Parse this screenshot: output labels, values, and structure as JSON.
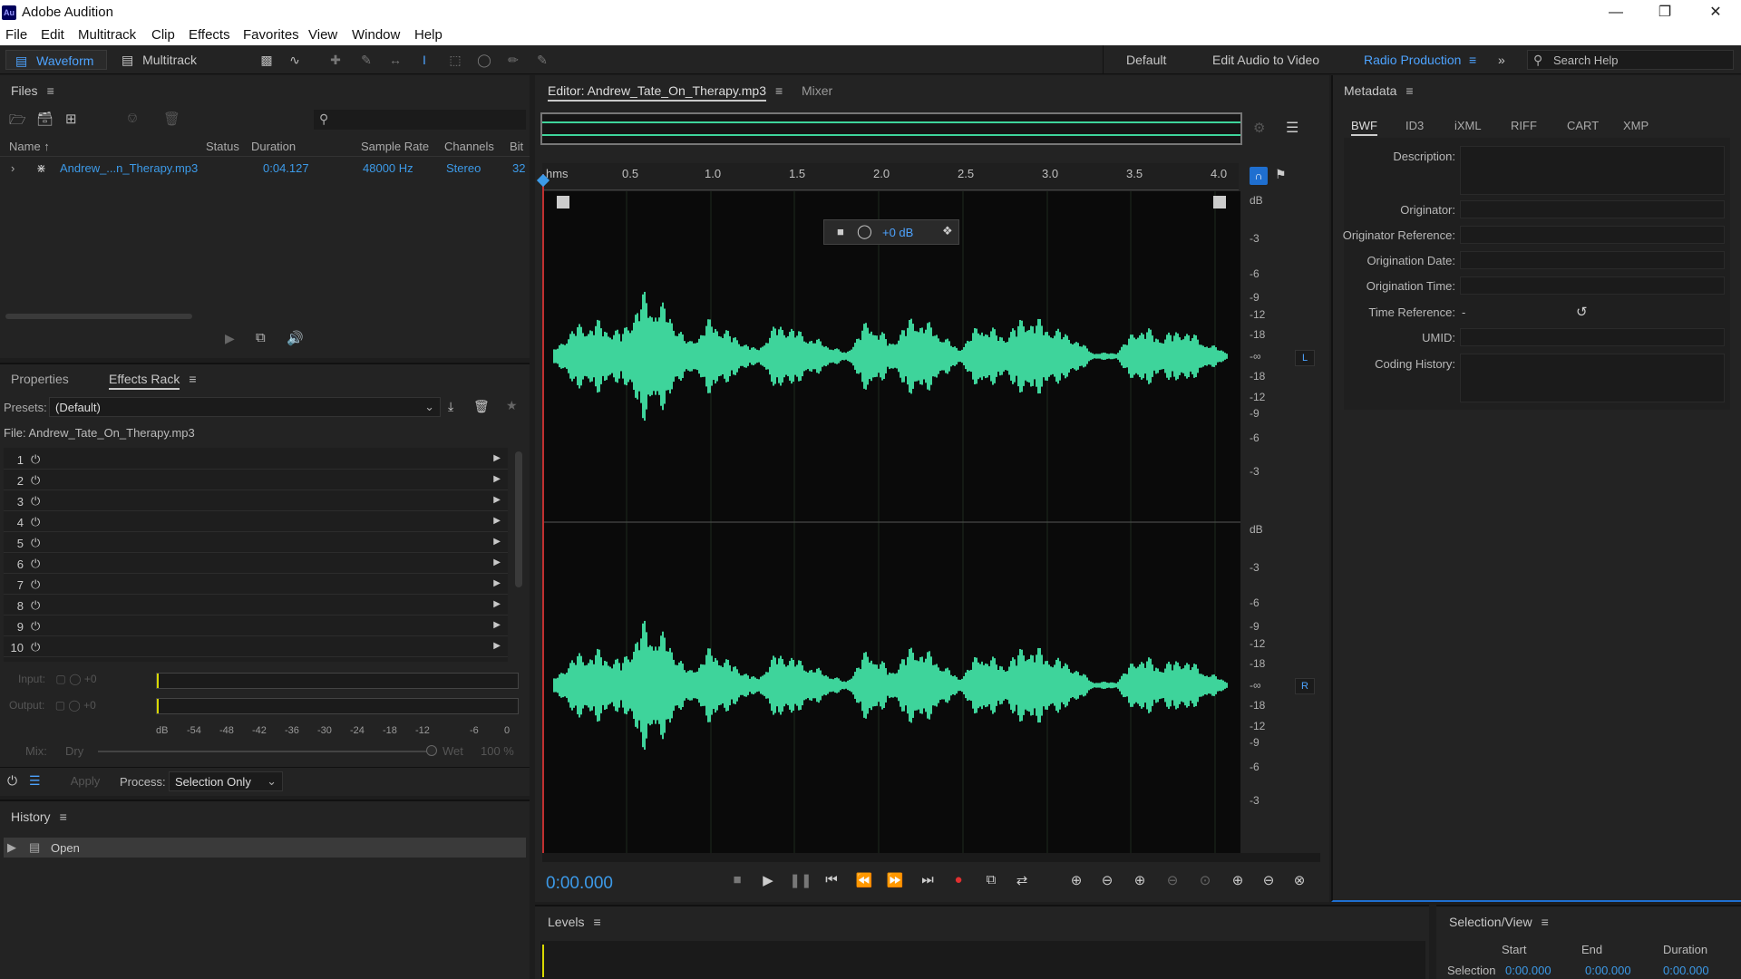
{
  "app": {
    "title": "Adobe Audition",
    "logo": "Au"
  },
  "menu": [
    "File",
    "Edit",
    "Multitrack",
    "Clip",
    "Effects",
    "Favorites",
    "View",
    "Window",
    "Help"
  ],
  "toolbar": {
    "waveform_label": "Waveform",
    "multitrack_label": "Multitrack",
    "workspaces": [
      "Default",
      "Edit Audio to Video",
      "Radio Production"
    ],
    "search_placeholder": "Search Help"
  },
  "files": {
    "title": "Files",
    "columns": [
      "Name",
      "Status",
      "Duration",
      "Sample Rate",
      "Channels",
      "Bit"
    ],
    "rows": [
      {
        "name": "Andrew_...n_Therapy.mp3",
        "duration": "0:04.127",
        "sample_rate": "48000 Hz",
        "channels": "Stereo",
        "bit": "32"
      }
    ]
  },
  "effects": {
    "tabs": [
      "Properties",
      "Effects Rack"
    ],
    "presets_label": "Presets:",
    "presets_value": "(Default)",
    "file_label": "File: Andrew_Tate_On_Therapy.mp3",
    "slots": [
      "1",
      "2",
      "3",
      "4",
      "5",
      "6",
      "7",
      "8",
      "9",
      "10"
    ],
    "input_label": "Input:",
    "output_label": "Output:",
    "input_value": "+0",
    "output_value": "+0",
    "meter_scale": [
      "dB",
      "-54",
      "-48",
      "-42",
      "-36",
      "-30",
      "-24",
      "-18",
      "-12",
      "-6",
      "0"
    ],
    "mix_label": "Mix:",
    "dry_label": "Dry",
    "wet_label": "Wet",
    "wet_value": "100 %",
    "apply_label": "Apply",
    "process_label": "Process:",
    "process_value": "Selection Only"
  },
  "history": {
    "title": "History",
    "items": [
      "Open"
    ]
  },
  "editor": {
    "tab_label": "Editor: Andrew_Tate_On_Therapy.mp3",
    "mixer_label": "Mixer",
    "ruler_unit": "hms",
    "ruler_ticks": [
      "0.5",
      "1.0",
      "1.5",
      "2.0",
      "2.5",
      "3.0",
      "3.5",
      "4.0"
    ],
    "gain_value": "+0 dB",
    "db_scale_label": "dB",
    "db_scale_top": [
      "-3",
      "-6",
      "-9",
      "-12",
      "-18",
      "-∞",
      "-18",
      "-12",
      "-9",
      "-6",
      "-3"
    ],
    "channel_left": "L",
    "channel_right": "R",
    "time_display": "0:00.000",
    "wave_color": "#3ed49b",
    "playhead_color": "#e03030"
  },
  "metadata": {
    "title": "Metadata",
    "tabs": [
      "BWF",
      "ID3",
      "iXML",
      "RIFF",
      "CART",
      "XMP"
    ],
    "fields": [
      "Description:",
      "Originator:",
      "Originator Reference:",
      "Origination Date:",
      "Origination Time:",
      "Time Reference:",
      "UMID:",
      "Coding History:"
    ],
    "time_reference_value": "-"
  },
  "levels": {
    "title": "Levels"
  },
  "selection_view": {
    "title": "Selection/View",
    "columns": [
      "Start",
      "End",
      "Duration"
    ],
    "row_label": "Selection",
    "start": "0:00.000",
    "end": "0:00.000",
    "duration": "0:00.000"
  }
}
